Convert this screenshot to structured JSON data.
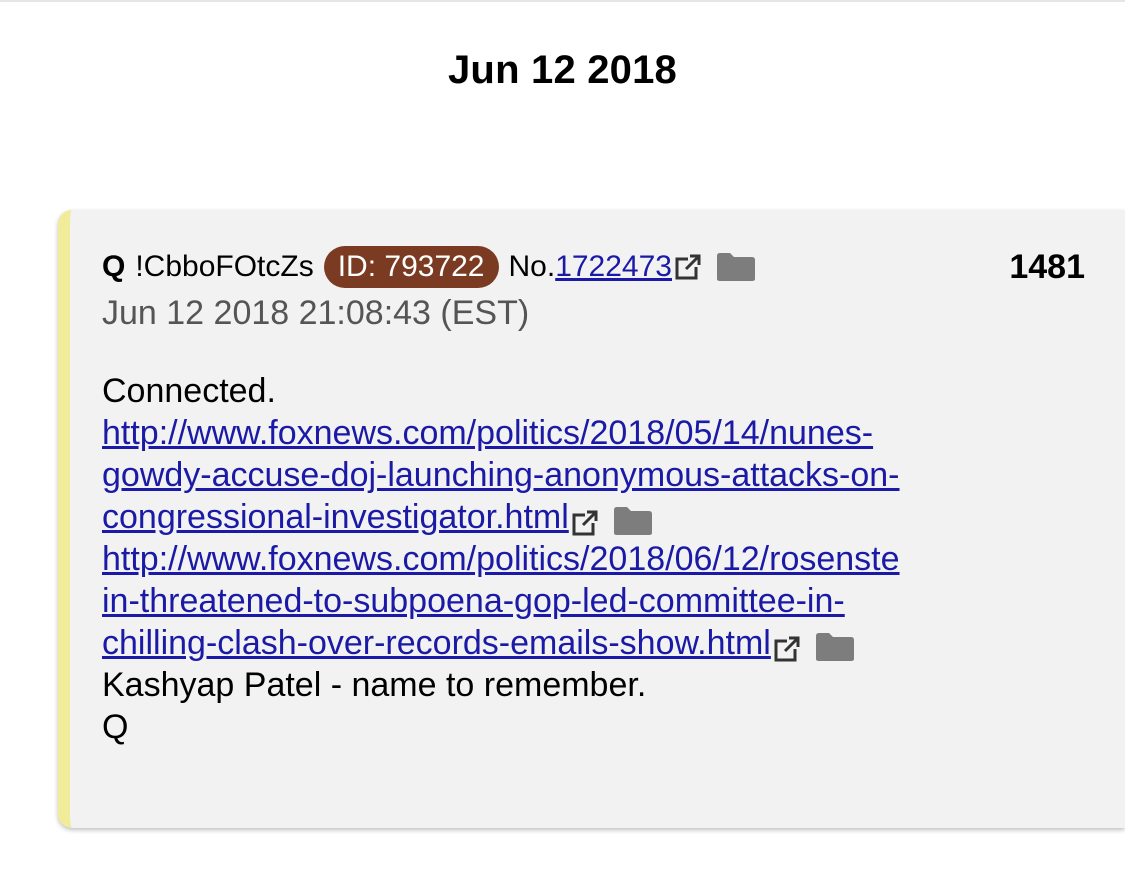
{
  "page": {
    "date_heading": "Jun 12 2018"
  },
  "post": {
    "author": "Q",
    "tripcode": "!CbboFOtcZs",
    "id_badge": "ID: 793722",
    "no_label": "No.",
    "no_link": "1722473",
    "post_number": "1481",
    "timestamp": "Jun 12 2018 21:08:43 (EST)",
    "colors": {
      "id_badge_bg": "#7b3b22",
      "link": "#1a1aa6",
      "card_bg": "#f2f2f2",
      "card_accent": "#f0ec9a"
    },
    "icons": [
      "external-link-icon",
      "folder-icon"
    ],
    "body": {
      "line1": "Connected.",
      "link1": {
        "part1": "http://www.foxnews.com/politics/2018/05/14/nunes-",
        "part2": "gowdy-accuse-doj-launching-anonymous-attacks-on-",
        "part3": "congressional-investigator.html"
      },
      "link2": {
        "part1": "http://www.foxnews.com/politics/2018/06/12/rosenste",
        "part2": "in-threatened-to-subpoena-gop-led-committee-in-",
        "part3": "chilling-clash-over-records-emails-show.html"
      },
      "line_patel": "Kashyap Patel - name to remember.",
      "signature": "Q"
    }
  }
}
